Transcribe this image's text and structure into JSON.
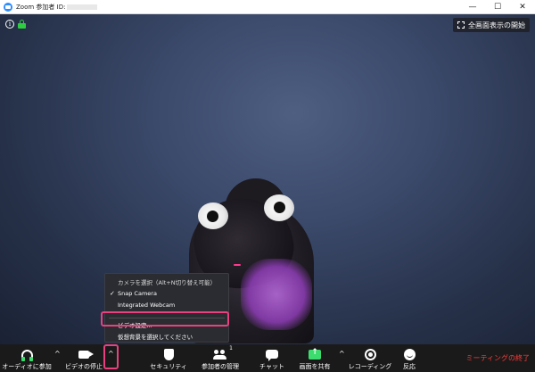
{
  "window": {
    "title": "Zoom 参加者 ID:",
    "minimize_glyph": "—",
    "maximize_glyph": "☐",
    "close_glyph": "✕"
  },
  "video": {
    "fullscreen_label": "全画面表示の開始",
    "info_icon_glyph": "i"
  },
  "camera_menu": {
    "header": "カメラを選択（Alt+N切り替え可能）",
    "check_glyph": "✓",
    "items": [
      {
        "label": "Snap Camera",
        "selected": true
      },
      {
        "label": "Integrated Webcam",
        "selected": false
      }
    ],
    "video_settings": "ビデオ設定...",
    "choose_background": "仮想背景を選択してください"
  },
  "toolbar": {
    "caret_glyph": "^",
    "audio_label": "オーディオに参加",
    "video_label": "ビデオの停止",
    "security_label": "セキュリティ",
    "participants_label": "参加者の管理",
    "participants_count": "1",
    "chat_label": "チャット",
    "share_label": "画面を共有",
    "record_label": "レコーディング",
    "reactions_label": "反応",
    "end_meeting_label": "ミーティングの終了"
  },
  "colors": {
    "accent_green": "#3ddc6e",
    "highlight_pink": "#e8417e",
    "end_red": "#ff3a3a"
  }
}
